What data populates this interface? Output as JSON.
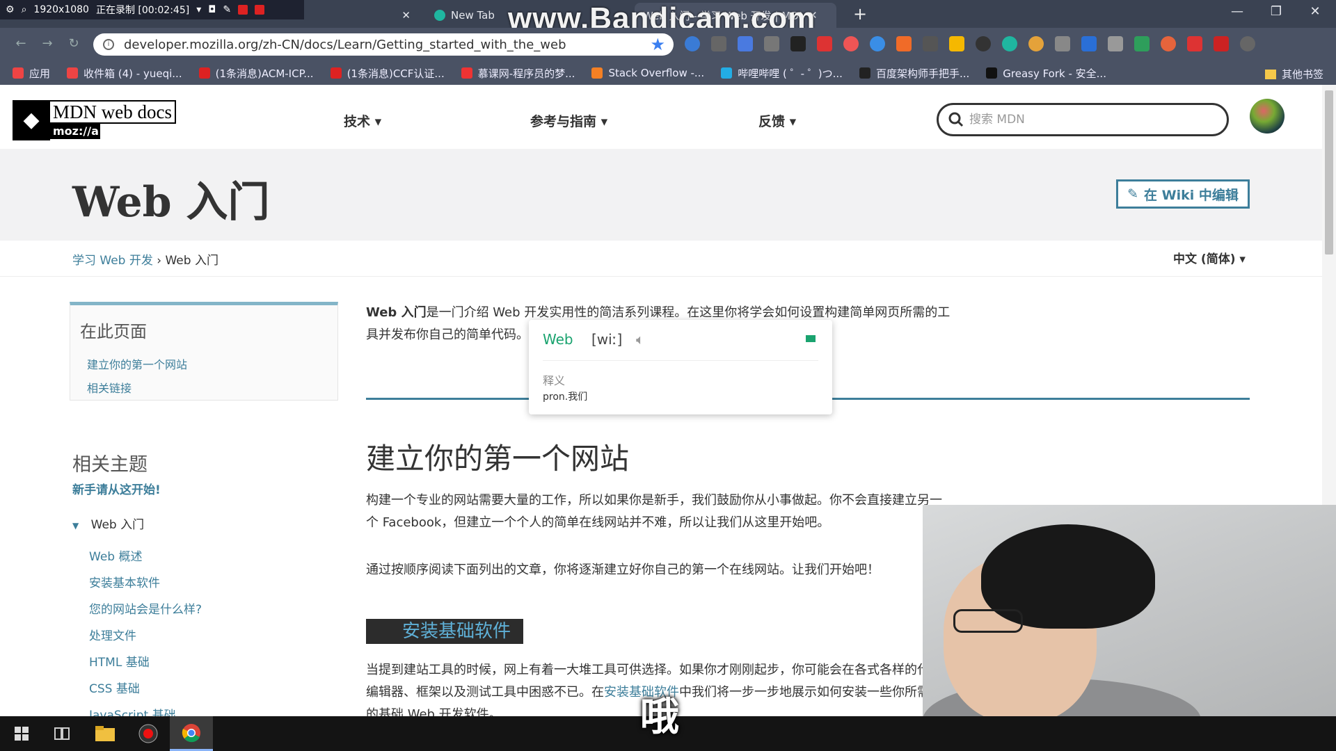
{
  "recorder": {
    "resolution": "1920x1080",
    "status": "正在录制 [00:02:45]"
  },
  "watermark": "www.Bandicam.com",
  "tabs": [
    {
      "title": ""
    },
    {
      "title": "New Tab"
    },
    {
      "title": "Web 入门 - 学习 Web 开发 | MDN"
    }
  ],
  "address": {
    "url": "developer.mozilla.org/zh-CN/docs/Learn/Getting_started_with_the_web"
  },
  "bookmarks": [
    {
      "label": "应用",
      "color": "#e44"
    },
    {
      "label": "收件箱 (4) - yueqi...",
      "color": "#e44"
    },
    {
      "label": "(1条消息)ACM-ICP...",
      "color": "#d22"
    },
    {
      "label": "(1条消息)CCF认证...",
      "color": "#d22"
    },
    {
      "label": "慕课网-程序员的梦...",
      "color": "#e33"
    },
    {
      "label": "Stack Overflow -...",
      "color": "#f48024"
    },
    {
      "label": "哔哩哔哩 ( ゜- ゜)つ...",
      "color": "#23ade5"
    },
    {
      "label": "百度架构师手把手...",
      "color": "#222"
    },
    {
      "label": "Greasy Fork - 安全...",
      "color": "#111"
    }
  ],
  "bookmarks_other": "其他书签",
  "mdn": {
    "logo_line1": "MDN web docs",
    "logo_line2": "moz://a",
    "nav": [
      "技术 ▾",
      "参考与指南 ▾",
      "反馈 ▾"
    ],
    "search_placeholder": "搜索 MDN",
    "page_title": "Web 入门",
    "edit_button": "在 Wiki 中编辑",
    "breadcrumb_parent": "学习 Web 开发",
    "breadcrumb_sep": " › ",
    "breadcrumb_current": "Web 入门",
    "language": "中文 (简体) ▾"
  },
  "toc": {
    "title": "在此页面",
    "items": [
      "建立你的第一个网站",
      "相关链接"
    ]
  },
  "related": {
    "title": "相关主题",
    "start_here": "新手请从这开始!",
    "group": "Web 入门",
    "group_arrow": "▼",
    "links": [
      "Web 概述",
      "安装基本软件",
      "您的网站会是什么样?",
      "处理文件",
      "HTML 基础",
      "CSS 基础",
      "JavaScript 基础"
    ]
  },
  "content": {
    "intro_bold": "Web 入门",
    "intro_rest": "是一门介绍 Web 开发实用性的简洁系列课程。在这里你将学会如何设置构建简单网页所需的工具并发布你自己的简单代码。",
    "h2": "建立你的第一个网站",
    "p1": "构建一个专业的网站需要大量的工作，所以如果你是新手，我们鼓励你从小事做起。你不会直接建立另一个 Facebook，但建立一个个人的简单在线网站并不难，所以让我们从这里开始吧。",
    "p2": "通过按顺序阅读下面列出的文章，你将逐渐建立好你自己的第一个在线网站。让我们开始吧！",
    "step_heading": "安装基础软件",
    "p3_a": "当提到建站工具的时候，网上有着一大堆工具可供选择。如果你才刚刚起步，你可能会在各式各样的代码编辑器、框架以及测试工具中困惑不已。在",
    "p3_link": "安装基础软件",
    "p3_b": "中我们将一步一步地展示如何安装一些你所需要的基础 Web 开发软件。"
  },
  "dictionary": {
    "word": "Web",
    "phonetic": "[wiː]",
    "label": "释义",
    "definition": "pron.我们"
  },
  "subtitle": "哦"
}
